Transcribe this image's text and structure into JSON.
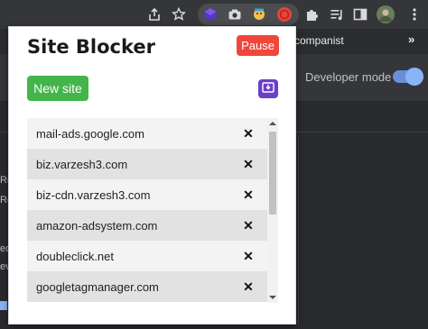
{
  "browser": {
    "toolbar_icons": [
      "share-icon",
      "star-icon",
      "extension-cube-icon",
      "camera-icon",
      "extension-face-icon",
      "record-icon",
      "puzzle-icon",
      "playlist-icon",
      "sidebar-icon",
      "avatar"
    ],
    "bookmark_text": "companist",
    "chevron": "»"
  },
  "background": {
    "developer_mode_label": "Developer mode",
    "side_fragments": [
      "Re",
      "Re",
      "eo",
      "ev"
    ]
  },
  "popup": {
    "title": "Site Blocker",
    "pause_label": "Pause",
    "new_site_label": "New site",
    "sites": [
      "mail-ads.google.com",
      "biz.varzesh3.com",
      "biz-cdn.varzesh3.com",
      "amazon-adsystem.com",
      "doubleclick.net",
      "googletagmanager.com"
    ],
    "delete_glyph": "✕"
  },
  "colors": {
    "pause": "#f0473c",
    "new_site": "#44b54a",
    "import": "#6a3fc9"
  }
}
